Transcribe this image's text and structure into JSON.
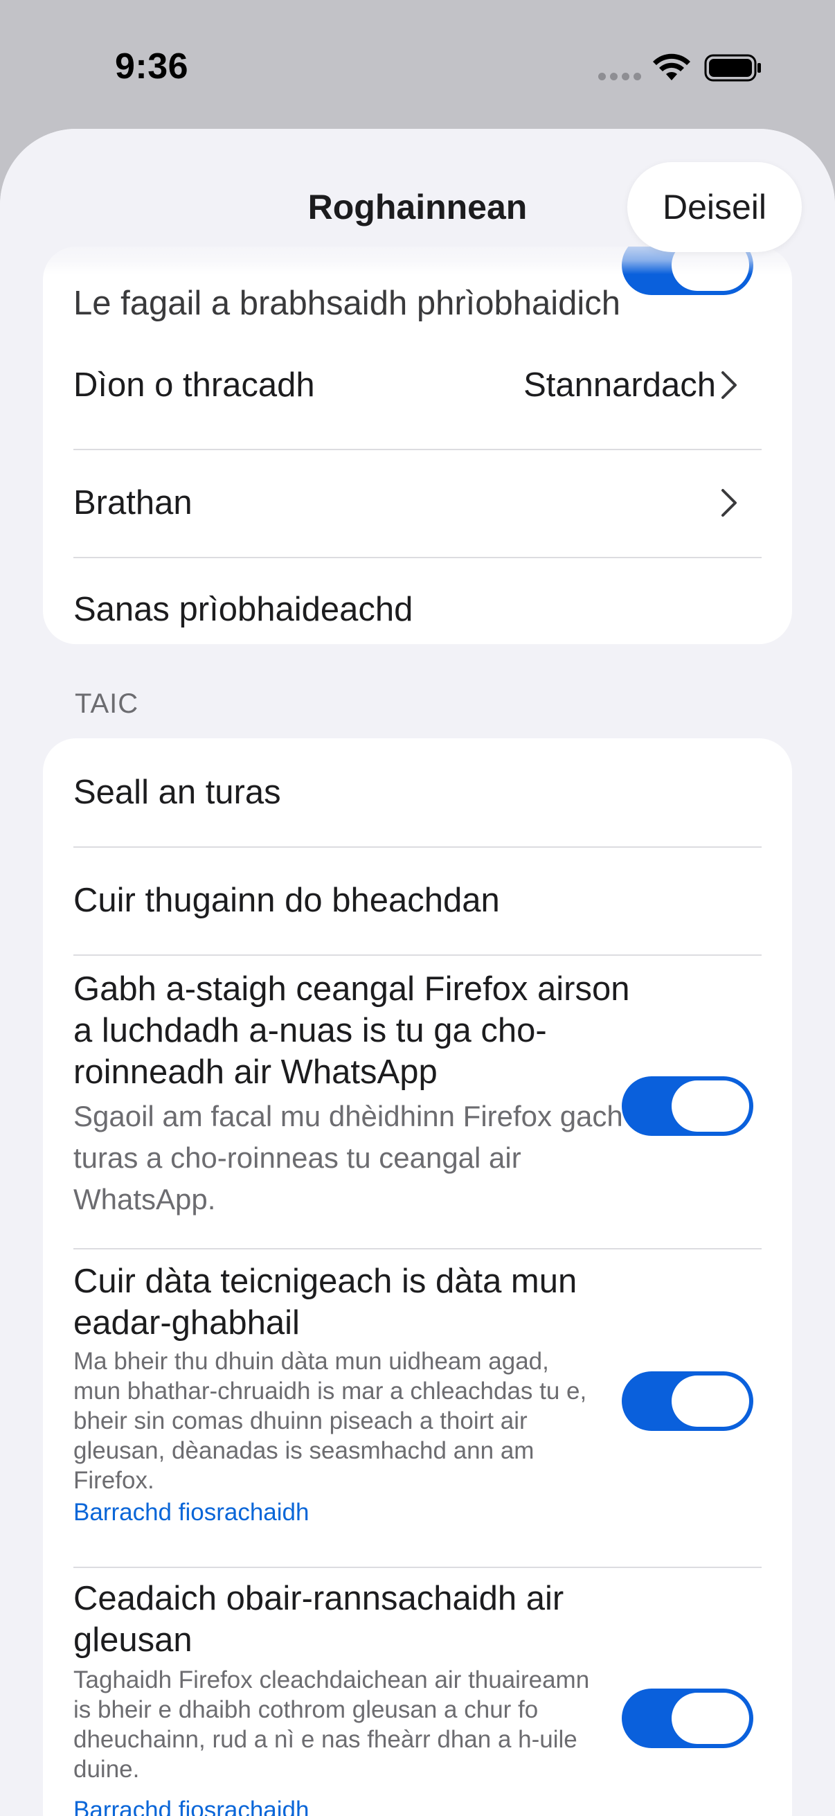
{
  "status_bar": {
    "time": "9:36"
  },
  "nav": {
    "title": "Roghainnean",
    "done_label": "Deiseil"
  },
  "privacy_card": {
    "partial_row_label": "Le fagail a brabhsaidh phrìobhaidich",
    "tracking_protection": {
      "label": "Dìon o thracadh",
      "value": "Stannardach"
    },
    "notifications": {
      "label": "Brathan"
    },
    "privacy_notice": {
      "label": "Sanas prìobhaideachd"
    }
  },
  "support_section": {
    "header": "TAIC",
    "show_tour": "Seall an turas",
    "send_feedback": "Cuir thugainn do bheachdan",
    "whatsapp": {
      "title": "Gabh a-staigh ceangal Firefox airson a luchdadh a-nuas is tu ga cho-roinneadh air WhatsApp",
      "description": "Sgaoil am facal mu dhèidhinn Firefox gach turas a cho-roinneas tu ceangal air WhatsApp.",
      "enabled": true
    },
    "technical_data": {
      "title": "Cuir dàta teicnigeach is dàta mun eadar-ghabhail",
      "description": "Ma bheir thu dhuin dàta mun uidheam agad, mun bhathar-chruaidh is mar a chleachdas tu e, bheir sin comas dhuinn piseach a thoirt air gleusan, dèanadas is seasmhachd ann am Firefox.",
      "learn_more": "Barrachd fiosrachaidh",
      "enabled": true
    },
    "studies": {
      "title": "Ceadaich obair-rannsachaidh air gleusan",
      "description": "Taghaidh Firefox cleachdaichean air thuaireamn is bheir e dhaibh cothrom gleusan a chur fo dheuchainn, rud a nì e nas fheàrr dhan a h-uile duine.",
      "learn_more": "Barrachd fiosrachaidh",
      "enabled": true
    }
  },
  "colors": {
    "accent": "#0a60dc",
    "link": "#0a66d8",
    "background": "#f2f2f7"
  }
}
